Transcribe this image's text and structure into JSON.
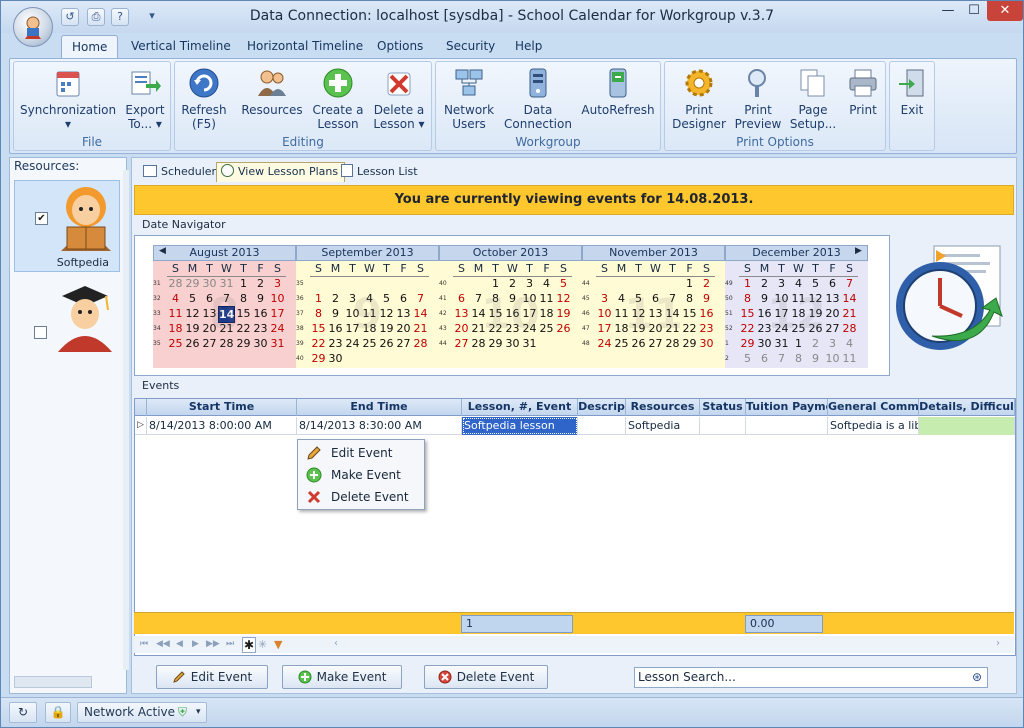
{
  "window": {
    "title": "Data Connection: localhost [sysdba] - School Calendar for Workgroup v.3.7"
  },
  "ribbon_tabs": [
    "Home",
    "Vertical Timeline",
    "Horizontal Timeline",
    "Options",
    "Security",
    "Help"
  ],
  "ribbon": {
    "groups": {
      "file": "File",
      "editing": "Editing",
      "workgroup": "Workgroup",
      "print": "Print Options"
    },
    "buttons": {
      "sync": {
        "l1": "Synchronization",
        "l2": "▾"
      },
      "export": {
        "l1": "Export",
        "l2": "To... ▾"
      },
      "refresh": {
        "l1": "Refresh",
        "l2": "(F5)"
      },
      "resources": {
        "l1": "Resources"
      },
      "create": {
        "l1": "Create a",
        "l2": "Lesson"
      },
      "delete": {
        "l1": "Delete a",
        "l2": "Lesson ▾"
      },
      "netusers": {
        "l1": "Network",
        "l2": "Users"
      },
      "dataconn": {
        "l1": "Data",
        "l2": "Connection"
      },
      "autorefresh": {
        "l1": "AutoRefresh"
      },
      "printdesigner": {
        "l1": "Print",
        "l2": "Designer"
      },
      "printpreview": {
        "l1": "Print",
        "l2": "Preview"
      },
      "pagesetup": {
        "l1": "Page",
        "l2": "Setup..."
      },
      "print": {
        "l1": "Print"
      },
      "exit": {
        "l1": "Exit"
      }
    }
  },
  "resources_panel": {
    "header": "Resources:",
    "items": [
      {
        "name": "Softpedia",
        "checked": "✔"
      },
      {
        "name": "",
        "checked": ""
      }
    ]
  },
  "view_tabs": [
    "Scheduler",
    "View Lesson Plans",
    "Lesson List"
  ],
  "banner": "You are currently viewing events for 14.08.2013.",
  "date_navigator": {
    "label": "Date Navigator",
    "weekdays": [
      "S",
      "M",
      "T",
      "W",
      "T",
      "F",
      "S"
    ],
    "months": [
      {
        "name": "August 2013",
        "bg": "#f9d0d0",
        "wm": "8",
        "weeks": [
          [
            "31",
            [
              "28",
              "29",
              "30",
              "31",
              "1",
              "2",
              "3"
            ]
          ],
          [
            "32",
            [
              "4",
              "5",
              "6",
              "7",
              "8",
              "9",
              "10"
            ]
          ],
          [
            "33",
            [
              "11",
              "12",
              "13",
              "14",
              "15",
              "16",
              "17"
            ]
          ],
          [
            "34",
            [
              "18",
              "19",
              "20",
              "21",
              "22",
              "23",
              "24"
            ]
          ],
          [
            "35",
            [
              "25",
              "26",
              "27",
              "28",
              "29",
              "30",
              "31"
            ]
          ],
          [
            "",
            [
              "",
              "",
              "",
              "",
              "",
              "",
              ""
            ]
          ]
        ],
        "dim_start": 4,
        "dim_end": 0,
        "today": "14"
      },
      {
        "name": "September 2013",
        "bg": "#fffbd4",
        "wm": "9",
        "weeks": [
          [
            "35",
            [
              "",
              "",
              "",
              "",
              "",
              "",
              ""
            ]
          ],
          [
            "36",
            [
              "1",
              "2",
              "3",
              "4",
              "5",
              "6",
              "7"
            ]
          ],
          [
            "37",
            [
              "8",
              "9",
              "10",
              "11",
              "12",
              "13",
              "14"
            ]
          ],
          [
            "38",
            [
              "15",
              "16",
              "17",
              "18",
              "19",
              "20",
              "21"
            ]
          ],
          [
            "39",
            [
              "22",
              "23",
              "24",
              "25",
              "26",
              "27",
              "28"
            ]
          ],
          [
            "40",
            [
              "29",
              "30",
              "",
              "",
              "",
              "",
              ""
            ]
          ]
        ],
        "dim_start": 0,
        "dim_end": 0,
        "today": ""
      },
      {
        "name": "October 2013",
        "bg": "#fffbd4",
        "wm": "10",
        "weeks": [
          [
            "40",
            [
              "",
              "",
              "1",
              "2",
              "3",
              "4",
              "5"
            ]
          ],
          [
            "41",
            [
              "6",
              "7",
              "8",
              "9",
              "10",
              "11",
              "12"
            ]
          ],
          [
            "42",
            [
              "13",
              "14",
              "15",
              "16",
              "17",
              "18",
              "19"
            ]
          ],
          [
            "43",
            [
              "20",
              "21",
              "22",
              "23",
              "24",
              "25",
              "26"
            ]
          ],
          [
            "44",
            [
              "27",
              "28",
              "29",
              "30",
              "31",
              "",
              ""
            ]
          ],
          [
            "",
            [
              "",
              "",
              "",
              "",
              "",
              "",
              ""
            ]
          ]
        ],
        "dim_start": 0,
        "dim_end": 0,
        "today": ""
      },
      {
        "name": "November 2013",
        "bg": "#fffbd4",
        "wm": "11",
        "weeks": [
          [
            "44",
            [
              "",
              "",
              "",
              "",
              "",
              "1",
              "2"
            ]
          ],
          [
            "45",
            [
              "3",
              "4",
              "5",
              "6",
              "7",
              "8",
              "9"
            ]
          ],
          [
            "46",
            [
              "10",
              "11",
              "12",
              "13",
              "14",
              "15",
              "16"
            ]
          ],
          [
            "47",
            [
              "17",
              "18",
              "19",
              "20",
              "21",
              "22",
              "23"
            ]
          ],
          [
            "48",
            [
              "24",
              "25",
              "26",
              "27",
              "28",
              "29",
              "30"
            ]
          ],
          [
            "",
            [
              "",
              "",
              "",
              "",
              "",
              "",
              ""
            ]
          ]
        ],
        "dim_start": 0,
        "dim_end": 0,
        "today": ""
      },
      {
        "name": "December 2013",
        "bg": "#e6e6f7",
        "wm": "12",
        "weeks": [
          [
            "49",
            [
              "1",
              "2",
              "3",
              "4",
              "5",
              "6",
              "7"
            ]
          ],
          [
            "50",
            [
              "8",
              "9",
              "10",
              "11",
              "12",
              "13",
              "14"
            ]
          ],
          [
            "51",
            [
              "15",
              "16",
              "17",
              "18",
              "19",
              "20",
              "21"
            ]
          ],
          [
            "52",
            [
              "22",
              "23",
              "24",
              "25",
              "26",
              "27",
              "28"
            ]
          ],
          [
            "1",
            [
              "29",
              "30",
              "31",
              "1",
              "2",
              "3",
              "4"
            ]
          ],
          [
            "2",
            [
              "5",
              "6",
              "7",
              "8",
              "9",
              "10",
              "11"
            ]
          ]
        ],
        "dim_start": 0,
        "dim_end": 10,
        "today": ""
      }
    ]
  },
  "events": {
    "label": "Events",
    "columns": [
      "Start Time",
      "End Time",
      "Lesson, #, Event",
      "Descrip",
      "Resources",
      "Status",
      "Tuition Payme",
      "General Comme",
      "Details, Difficul"
    ],
    "rows": [
      [
        "8/14/2013 8:00:00 AM",
        "8/14/2013 8:30:00 AM",
        "Softpedia lesson",
        "",
        "Softpedia",
        "",
        "",
        "Softpedia is a libra",
        ""
      ]
    ],
    "footer": {
      "count": "1",
      "total": "0.00"
    }
  },
  "context_menu": [
    "Edit Event",
    "Make Event",
    "Delete Event"
  ],
  "bottom_buttons": {
    "edit": "Edit Event",
    "make": "Make Event",
    "delete": "Delete Event"
  },
  "search": {
    "placeholder": "Lesson Search..."
  },
  "status": {
    "network": "Network Active"
  }
}
